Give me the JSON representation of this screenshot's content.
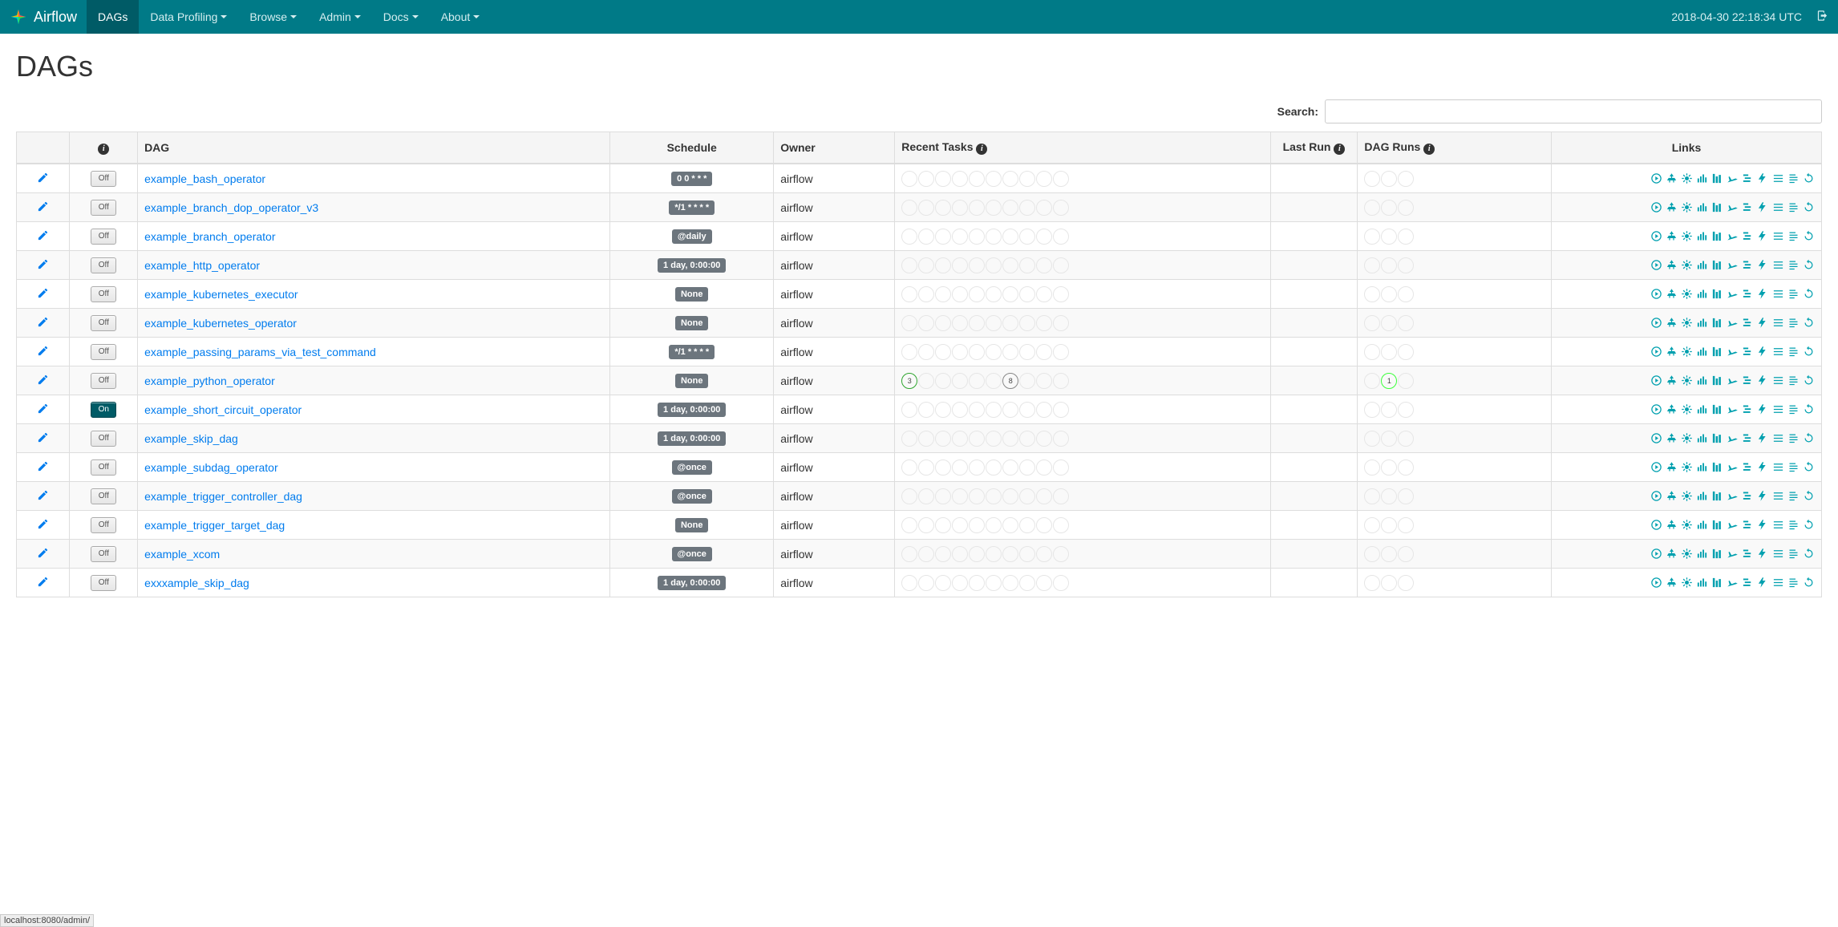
{
  "brand": "Airflow",
  "nav": {
    "dags": "DAGs",
    "data_profiling": "Data Profiling",
    "browse": "Browse",
    "admin": "Admin",
    "docs": "Docs",
    "about": "About"
  },
  "timestamp": "2018-04-30 22:18:34 UTC",
  "page_title": "DAGs",
  "search_label": "Search:",
  "columns": {
    "dag": "DAG",
    "schedule": "Schedule",
    "owner": "Owner",
    "recent_tasks": "Recent Tasks",
    "last_run": "Last Run",
    "dag_runs": "DAG Runs",
    "links": "Links"
  },
  "toggle_on": "On",
  "toggle_off": "Off",
  "link_icons": [
    "trigger",
    "tree",
    "graph",
    "tasks",
    "duration",
    "landing",
    "gantt",
    "tries",
    "zoom",
    "logs",
    "refresh"
  ],
  "dags": [
    {
      "on": false,
      "name": "example_bash_operator",
      "schedule": "0 0 * * *",
      "owner": "airflow",
      "recent": [],
      "runs": []
    },
    {
      "on": false,
      "name": "example_branch_dop_operator_v3",
      "schedule": "*/1 * * * *",
      "owner": "airflow",
      "recent": [],
      "runs": []
    },
    {
      "on": false,
      "name": "example_branch_operator",
      "schedule": "@daily",
      "owner": "airflow",
      "recent": [],
      "runs": []
    },
    {
      "on": false,
      "name": "example_http_operator",
      "schedule": "1 day, 0:00:00",
      "owner": "airflow",
      "recent": [],
      "runs": []
    },
    {
      "on": false,
      "name": "example_kubernetes_executor",
      "schedule": "None",
      "owner": "airflow",
      "recent": [],
      "runs": []
    },
    {
      "on": false,
      "name": "example_kubernetes_operator",
      "schedule": "None",
      "owner": "airflow",
      "recent": [],
      "runs": []
    },
    {
      "on": false,
      "name": "example_passing_params_via_test_command",
      "schedule": "*/1 * * * *",
      "owner": "airflow",
      "recent": [],
      "runs": []
    },
    {
      "on": false,
      "name": "example_python_operator",
      "schedule": "None",
      "owner": "airflow",
      "recent": [
        {
          "pos": 0,
          "state": "success",
          "count": "3"
        },
        {
          "pos": 6,
          "state": "grey",
          "count": "8"
        }
      ],
      "runs": [
        {
          "pos": 1,
          "state": "running",
          "count": "1"
        }
      ]
    },
    {
      "on": true,
      "name": "example_short_circuit_operator",
      "schedule": "1 day, 0:00:00",
      "owner": "airflow",
      "recent": [],
      "runs": []
    },
    {
      "on": false,
      "name": "example_skip_dag",
      "schedule": "1 day, 0:00:00",
      "owner": "airflow",
      "recent": [],
      "runs": []
    },
    {
      "on": false,
      "name": "example_subdag_operator",
      "schedule": "@once",
      "owner": "airflow",
      "recent": [],
      "runs": []
    },
    {
      "on": false,
      "name": "example_trigger_controller_dag",
      "schedule": "@once",
      "owner": "airflow",
      "recent": [],
      "runs": []
    },
    {
      "on": false,
      "name": "example_trigger_target_dag",
      "schedule": "None",
      "owner": "airflow",
      "recent": [],
      "runs": []
    },
    {
      "on": false,
      "name": "example_xcom",
      "schedule": "@once",
      "owner": "airflow",
      "recent": [],
      "runs": []
    },
    {
      "on": false,
      "name": "exxxample_skip_dag",
      "schedule": "1 day, 0:00:00",
      "owner": "airflow",
      "recent": [],
      "runs": []
    }
  ],
  "status_url": "localhost:8080/admin/"
}
